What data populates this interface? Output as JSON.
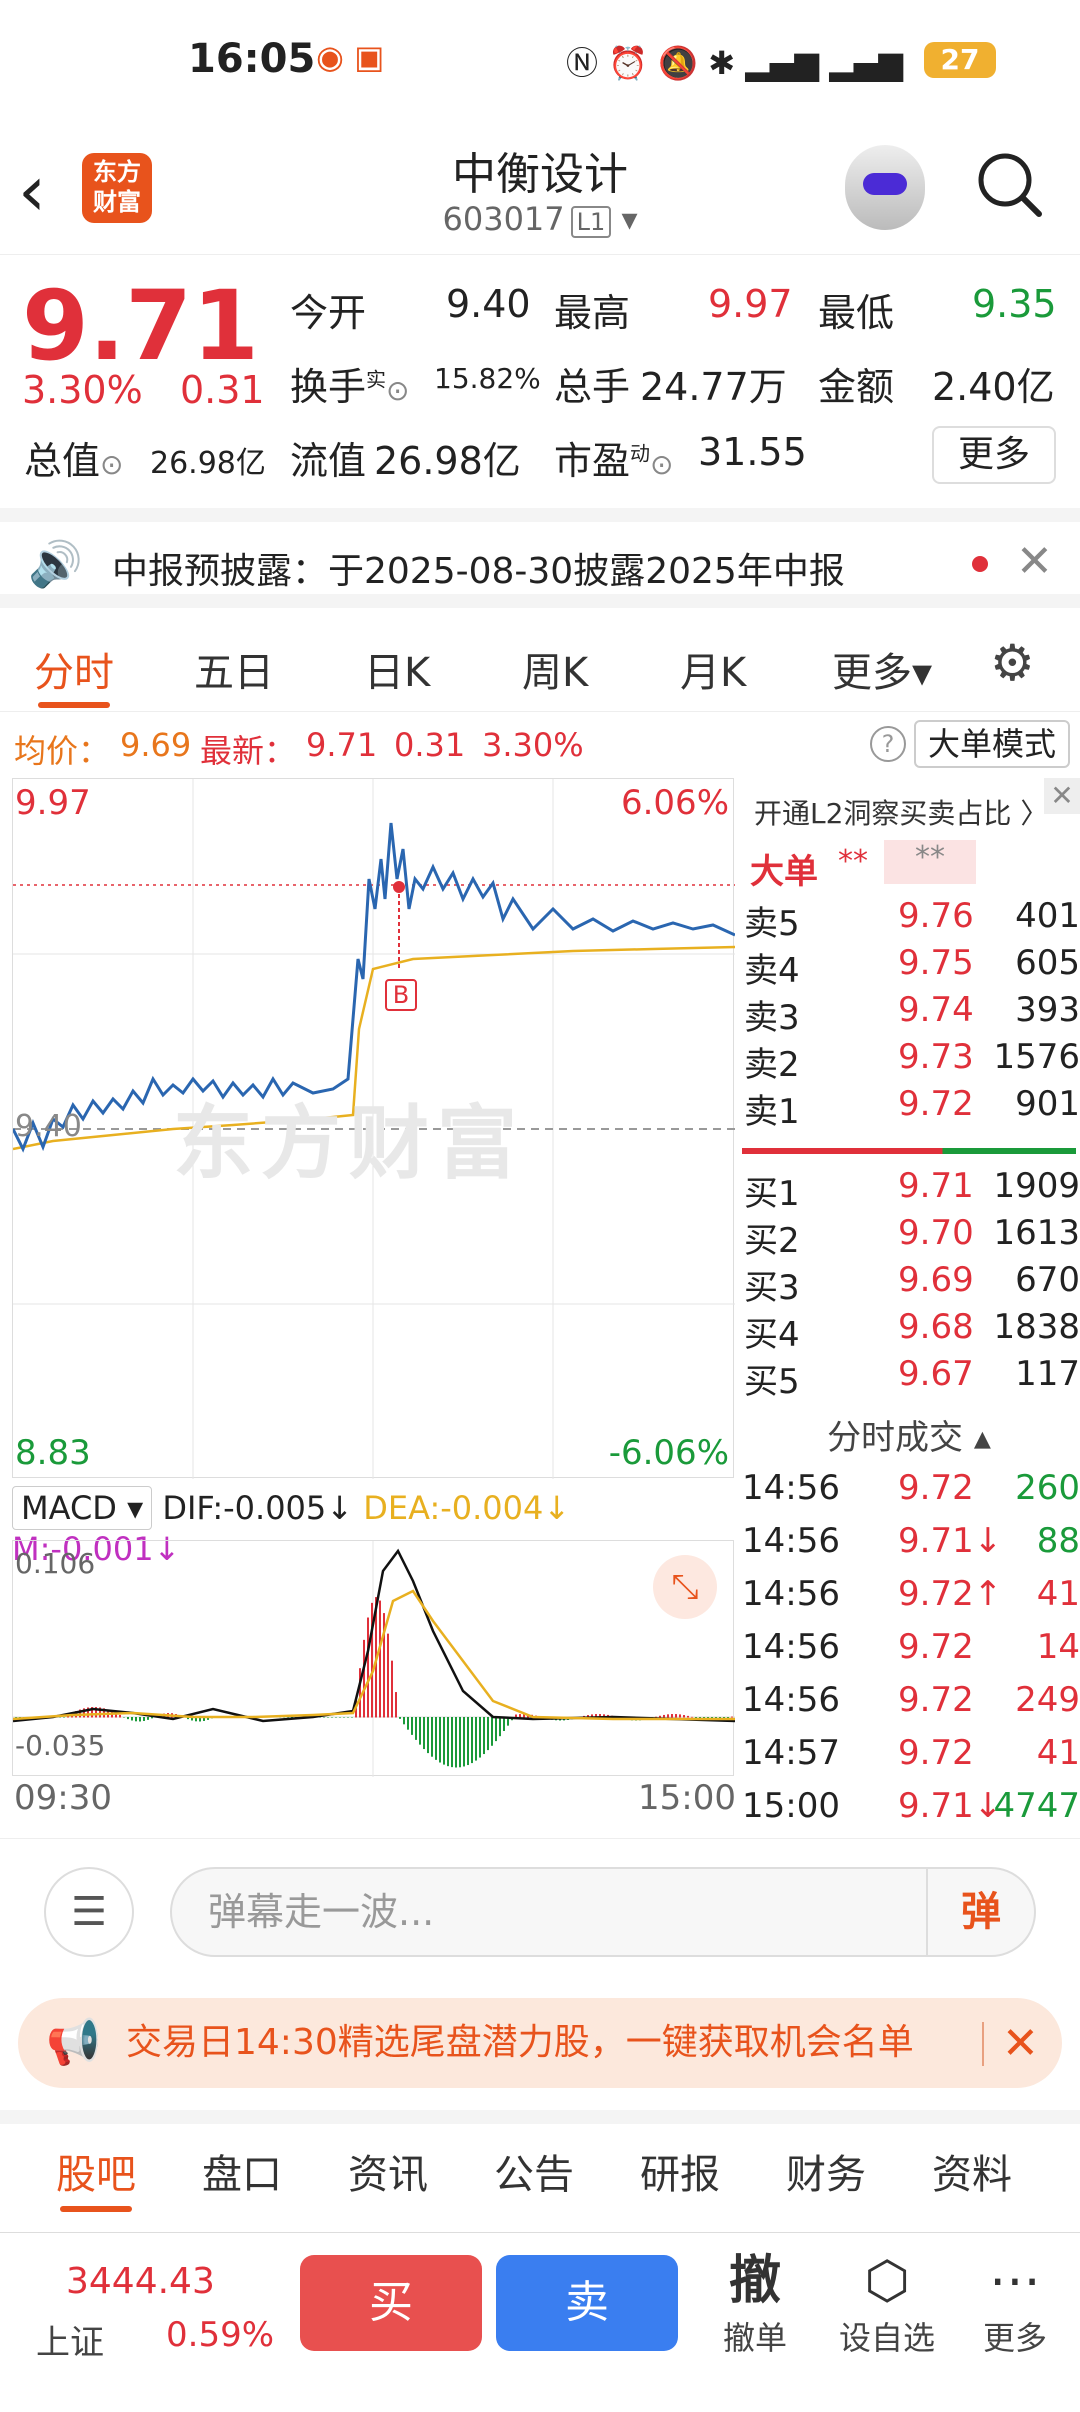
{
  "status": {
    "time": "16:05",
    "battery": "27"
  },
  "header": {
    "title": "中衡设计",
    "code": "603017",
    "level": "L1",
    "logo": "东方财富"
  },
  "quote": {
    "price": "9.71",
    "pct": "3.30%",
    "chg": "0.31",
    "open_label": "今开",
    "open": "9.40",
    "high_label": "最高",
    "high": "9.97",
    "low_label": "最低",
    "low": "9.35",
    "turnover_label": "换手",
    "turnover_sup": "实",
    "turnover": "15.82%",
    "vol_label": "总手",
    "vol": "24.77万",
    "amount_label": "金额",
    "amount": "2.40亿",
    "mktcap_label": "总值",
    "mktcap": "26.98亿",
    "float_label": "流值",
    "float": "26.98亿",
    "pe_label": "市盈",
    "pe_sup": "动",
    "pe": "31.55",
    "more": "更多"
  },
  "notice": {
    "text": "中报预披露：于2025-08-30披露2025年中报"
  },
  "tabs": [
    "分时",
    "五日",
    "日K",
    "周K",
    "月K",
    "更多▾"
  ],
  "info": {
    "avg_label": "均价：",
    "avg": "9.69",
    "last_label": "最新：",
    "last": "9.71",
    "chg": "0.31",
    "pct": "3.30%",
    "mode_btn": "大单模式",
    "help": "?"
  },
  "chart": {
    "y_max": "9.97",
    "y_min": "8.83",
    "pct_max": "6.06%",
    "pct_min": "-6.06%",
    "ref": "9.40",
    "marker": "B",
    "watermark": "东方财富",
    "start": "09:30",
    "end": "15:00",
    "colors": {
      "price": "#2a66b0",
      "avg": "#e8b020",
      "up": "#e0303a",
      "down": "#1a9a3a"
    }
  },
  "macd": {
    "name": "MACD ▾",
    "dif": "DIF:-0.005↓",
    "dea": "DEA:-0.004↓",
    "m": "M:-0.001↓",
    "top": "0.106",
    "bottom": "-0.035"
  },
  "panel": {
    "l2": "开通L2洞察买卖占比 〉",
    "big": "大单",
    "stars1": "**",
    "stars2": "**",
    "asks": [
      {
        "n": "卖5",
        "p": "9.76",
        "v": "401"
      },
      {
        "n": "卖4",
        "p": "9.75",
        "v": "605"
      },
      {
        "n": "卖3",
        "p": "9.74",
        "v": "393"
      },
      {
        "n": "卖2",
        "p": "9.73",
        "v": "1576"
      },
      {
        "n": "卖1",
        "p": "9.72",
        "v": "901"
      }
    ],
    "bids": [
      {
        "n": "买1",
        "p": "9.71",
        "v": "1909"
      },
      {
        "n": "买2",
        "p": "9.70",
        "v": "1613"
      },
      {
        "n": "买3",
        "p": "9.69",
        "v": "670"
      },
      {
        "n": "买4",
        "p": "9.68",
        "v": "1838"
      },
      {
        "n": "买5",
        "p": "9.67",
        "v": "117"
      }
    ],
    "trades_title": "分时成交 ▴",
    "trades": [
      {
        "t": "14:56",
        "p": "9.72",
        "v": "260"
      },
      {
        "t": "14:56",
        "p": "9.71↓",
        "v": "88"
      },
      {
        "t": "14:56",
        "p": "9.72↑",
        "v": "41"
      },
      {
        "t": "14:56",
        "p": "9.72",
        "v": "14"
      },
      {
        "t": "14:56",
        "p": "9.72",
        "v": "249"
      },
      {
        "t": "14:57",
        "p": "9.72",
        "v": "41"
      },
      {
        "t": "15:00",
        "p": "9.71↓",
        "v": "4747"
      }
    ]
  },
  "comment": {
    "placeholder": "弹幕走一波...",
    "dan": "弹"
  },
  "banner": {
    "text": "交易日14:30精选尾盘潜力股，一键获取机会名单"
  },
  "bottom_tabs": [
    "股吧",
    "盘口",
    "资讯",
    "公告",
    "研报",
    "财务",
    "资料"
  ],
  "bottom": {
    "index_val": "3444.43",
    "index_name": "上证",
    "index_pct": "0.59%",
    "buy": "买",
    "sell": "卖",
    "cancel_glyph": "撤",
    "cancel": "撤单",
    "watch": "设自选",
    "more": "更多"
  }
}
